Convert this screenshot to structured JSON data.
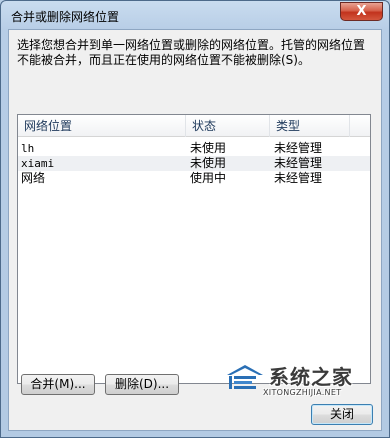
{
  "window": {
    "title": "合并或删除网络位置",
    "close_glyph": "X"
  },
  "description": "选择您想合并到单一网络位置或删除的网络位置。托管的网络位置不能被合并，而且正在使用的网络位置不能被删除(S)。",
  "list": {
    "columns": [
      "网络位置",
      "状态",
      "类型"
    ],
    "rows": [
      {
        "name": "lh",
        "status": "未使用",
        "type": "未经管理"
      },
      {
        "name": "xiami",
        "status": "未使用",
        "type": "未经管理"
      },
      {
        "name": "网络",
        "status": "使用中",
        "type": "未经管理"
      }
    ]
  },
  "buttons": {
    "merge": "合并(M)...",
    "delete": "删除(D)...",
    "close": "关闭"
  },
  "watermark": {
    "title": "系统之家",
    "url": "XITONGZHIJIA.NET"
  },
  "colors": {
    "title_bar": "#c9dcef",
    "close_button": "#c2331d",
    "client_bg": "#f0f0f0"
  }
}
